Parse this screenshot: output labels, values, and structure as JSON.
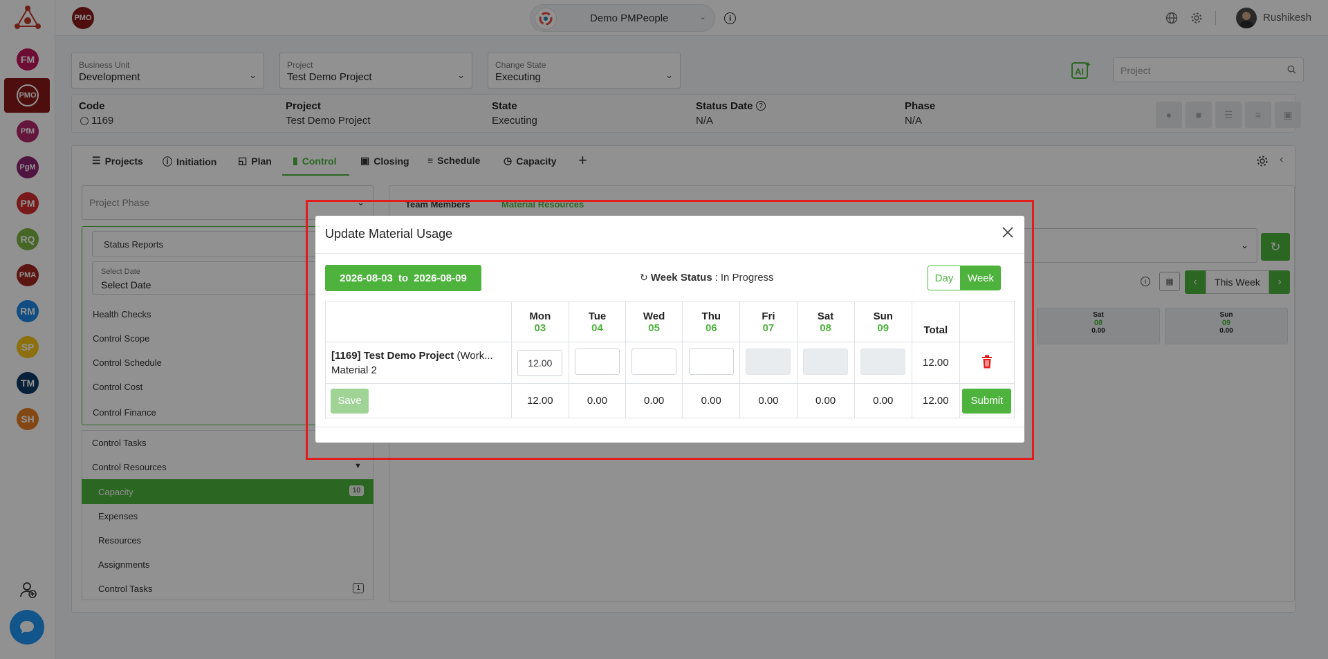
{
  "app": {
    "logo_badge": "PMO",
    "org_name": "Demo PMPeople",
    "user_name": "Rushikesh"
  },
  "sidebar": {
    "badges": [
      {
        "label": "FM",
        "color": "#c2185b"
      },
      {
        "label": "PMO",
        "color": "#8b1a1a"
      },
      {
        "label": "PfM",
        "color": "#b0286a"
      },
      {
        "label": "PgM",
        "color": "#8e2472"
      },
      {
        "label": "PM",
        "color": "#d32f2f"
      },
      {
        "label": "RQ",
        "color": "#7cb342"
      },
      {
        "label": "PMA",
        "color": "#a0281e"
      },
      {
        "label": "RM",
        "color": "#1e88e5"
      },
      {
        "label": "SP",
        "color": "#f5c518"
      },
      {
        "label": "TM",
        "color": "#0d3b66"
      },
      {
        "label": "SH",
        "color": "#e67e22"
      }
    ]
  },
  "filters": {
    "business_unit": {
      "label": "Business Unit",
      "value": "Development"
    },
    "project": {
      "label": "Project",
      "value": "Test Demo Project"
    },
    "change_state": {
      "label": "Change State",
      "value": "Executing"
    },
    "search_placeholder": "Project"
  },
  "summary": {
    "code_label": "Code",
    "code_value": "1169",
    "project_label": "Project",
    "project_value": "Test Demo Project",
    "state_label": "State",
    "state_value": "Executing",
    "status_date_label": "Status Date",
    "status_date_value": "N/A",
    "phase_label": "Phase",
    "phase_value": "N/A"
  },
  "tabs": [
    "Projects",
    "Initiation",
    "Plan",
    "Control",
    "Closing",
    "Schedule",
    "Capacity"
  ],
  "left_panel": {
    "phase_placeholder": "Project Phase",
    "status_reports": "Status Reports",
    "select_date_label": "Select Date",
    "select_date_value": "Select Date",
    "items": [
      "Health Checks",
      "Control Scope",
      "Control Schedule",
      "Control Cost",
      "Control Finance"
    ],
    "control_tasks": "Control Tasks",
    "control_resources": "Control Resources",
    "sub_items": [
      "Capacity",
      "Expenses",
      "Resources",
      "Assignments",
      "Control Tasks"
    ],
    "capacity_count": "10",
    "control_tasks_count": "1"
  },
  "right_panel": {
    "tab_team_members": "Team Members",
    "tab_material_resources": "Material Resources",
    "this_week": "This Week",
    "bg_days": [
      {
        "name": "Sat",
        "num": "08",
        "val": "0.00"
      },
      {
        "name": "Sun",
        "num": "09",
        "val": "0.00"
      }
    ]
  },
  "modal": {
    "title": "Update Material Usage",
    "date_from": "2026-08-03",
    "date_to_word": "to",
    "date_to": "2026-08-09",
    "week_status_label": "Week Status",
    "week_status_value": "In Progress",
    "toggle_day": "Day",
    "toggle_week": "Week",
    "days": [
      {
        "name": "Mon",
        "num": "03"
      },
      {
        "name": "Tue",
        "num": "04"
      },
      {
        "name": "Wed",
        "num": "05"
      },
      {
        "name": "Thu",
        "num": "06"
      },
      {
        "name": "Fri",
        "num": "07"
      },
      {
        "name": "Sat",
        "num": "08"
      },
      {
        "name": "Sun",
        "num": "09"
      }
    ],
    "total_header": "Total",
    "row": {
      "project_prefix": "[1169] Test Demo Project",
      "project_suffix": "(Work...",
      "material": "Material 2",
      "inputs": [
        "12.00",
        "",
        "",
        "",
        "",
        "",
        ""
      ],
      "total": "12.00"
    },
    "totals": [
      "12.00",
      "0.00",
      "0.00",
      "0.00",
      "0.00",
      "0.00",
      "0.00"
    ],
    "grand_total": "12.00",
    "save_label": "Save",
    "submit_label": "Submit"
  },
  "colors": {
    "accent": "#4db33d",
    "danger": "#e21b1b"
  }
}
